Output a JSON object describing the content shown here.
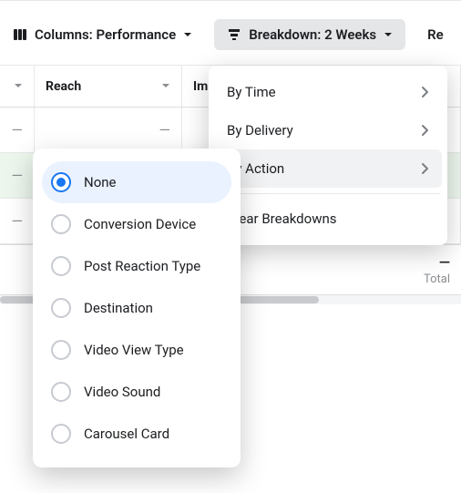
{
  "toolbar": {
    "columns_label": "Columns: Performance",
    "breakdown_label": "Breakdown: 2 Weeks",
    "reports_label": "Re"
  },
  "table": {
    "headers": {
      "reach": "Reach",
      "impressions": "Im"
    },
    "dash": "—",
    "footer": {
      "dash": "—",
      "total_label": "Total"
    }
  },
  "breakdown_menu": {
    "by_time": "By Time",
    "by_delivery": "By Delivery",
    "by_action": "By Action",
    "clear": "Clear Breakdowns"
  },
  "action_submenu": {
    "items": [
      {
        "label": "None",
        "selected": true
      },
      {
        "label": "Conversion Device",
        "selected": false
      },
      {
        "label": "Post Reaction Type",
        "selected": false
      },
      {
        "label": "Destination",
        "selected": false
      },
      {
        "label": "Video View Type",
        "selected": false
      },
      {
        "label": "Video Sound",
        "selected": false
      },
      {
        "label": "Carousel Card",
        "selected": false
      }
    ]
  }
}
